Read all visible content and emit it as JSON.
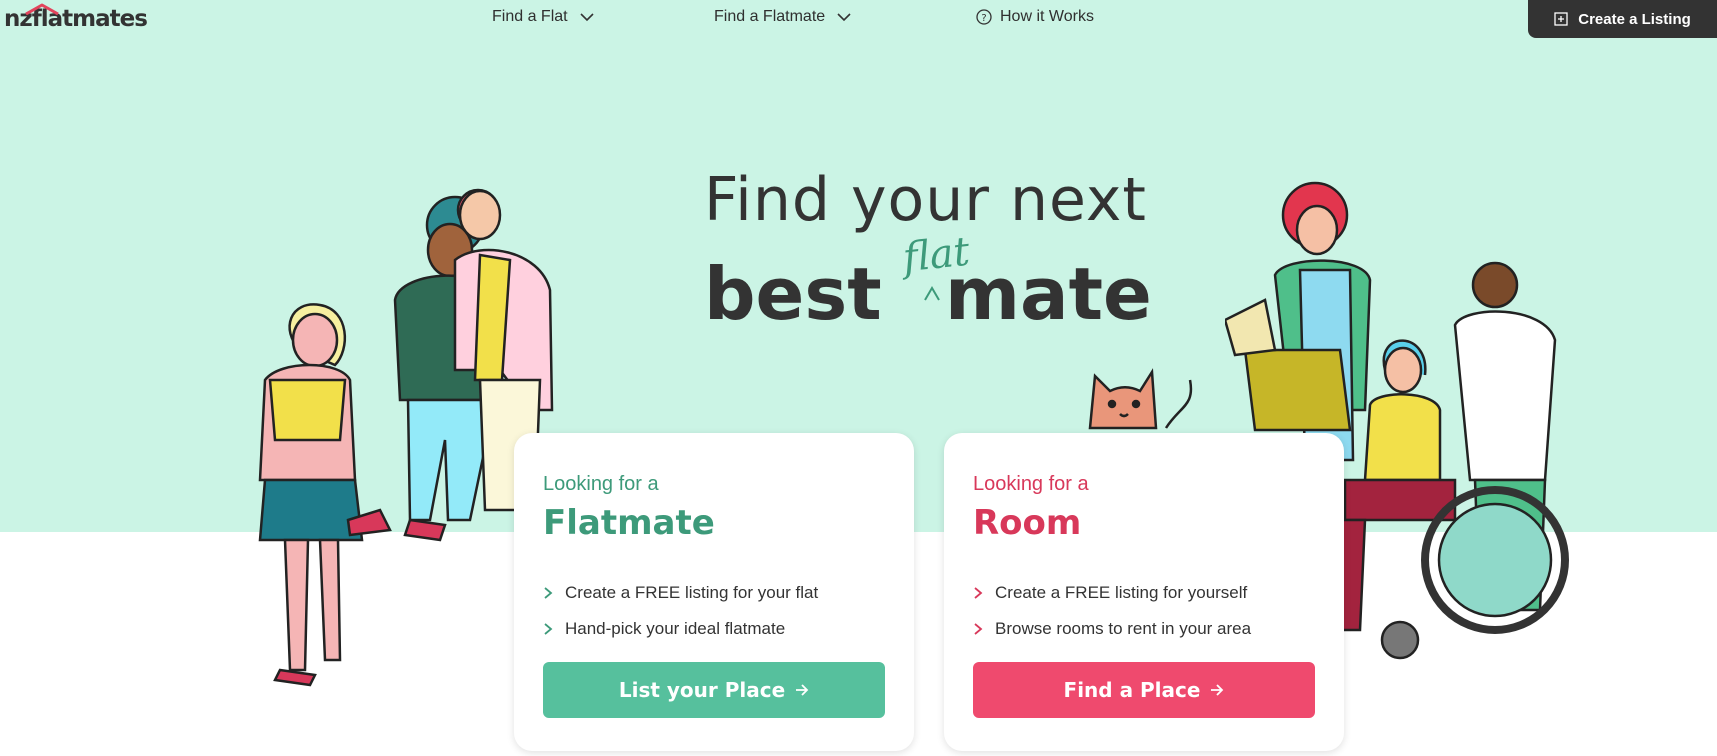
{
  "header": {
    "logo_text": "nzflatmates",
    "nav": [
      {
        "label": "Find a Flat",
        "icon": "chevron-down-icon"
      },
      {
        "label": "Find a Flatmate",
        "icon": "chevron-down-icon"
      },
      {
        "label": "How it Works",
        "icon": "question-circle-icon"
      }
    ],
    "create_listing_label": "Create a Listing"
  },
  "hero": {
    "line1": "Find your next",
    "line2_word1": "best",
    "line2_handwritten": "flat",
    "line2_word2": "mate"
  },
  "cards": [
    {
      "pre": "Looking for a",
      "title": "Flatmate",
      "items": [
        "Create a FREE listing for your flat",
        "Hand-pick your ideal flatmate"
      ],
      "button": "List your Place"
    },
    {
      "pre": "Looking for a",
      "title": "Room",
      "items": [
        "Create a FREE listing for yourself",
        "Browse rooms to rent in your area"
      ],
      "button": "Find a Place"
    }
  ],
  "colors": {
    "hero_bg": "#cbf4e5",
    "flatmate_accent": "#3d9a7a",
    "room_accent": "#d8385a",
    "green_button": "#56c09d",
    "red_button": "#ef4a6e",
    "dark": "#333333"
  }
}
